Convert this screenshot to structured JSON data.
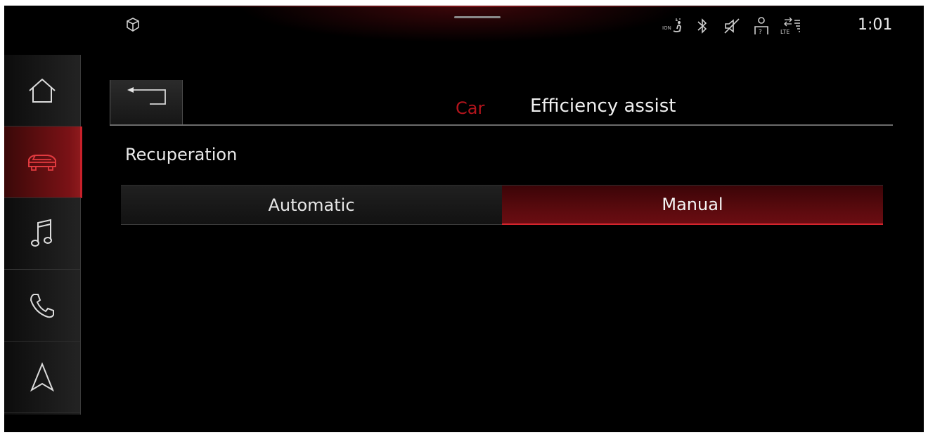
{
  "status_bar": {
    "time": "1:01",
    "icons": [
      "ion-seat-icon",
      "bluetooth-icon",
      "mute-icon",
      "user-help-icon",
      "lte-icon"
    ],
    "ion_label": "ION"
  },
  "sidebar": {
    "items": [
      {
        "name": "home",
        "icon": "home-icon",
        "active": false
      },
      {
        "name": "car",
        "icon": "car-icon",
        "active": true
      },
      {
        "name": "music",
        "icon": "music-note-icon",
        "active": false
      },
      {
        "name": "phone",
        "icon": "phone-icon",
        "active": false
      },
      {
        "name": "navigation",
        "icon": "navigation-arrow-icon",
        "active": false
      }
    ]
  },
  "header": {
    "breadcrumb": "Car",
    "title": "Efficiency assist"
  },
  "recuperation": {
    "label": "Recuperation",
    "options": [
      "Automatic",
      "Manual"
    ],
    "selected": "Manual"
  },
  "colors": {
    "accent": "#c8202a",
    "breadcrumb": "#b3141c",
    "background": "#000000"
  }
}
